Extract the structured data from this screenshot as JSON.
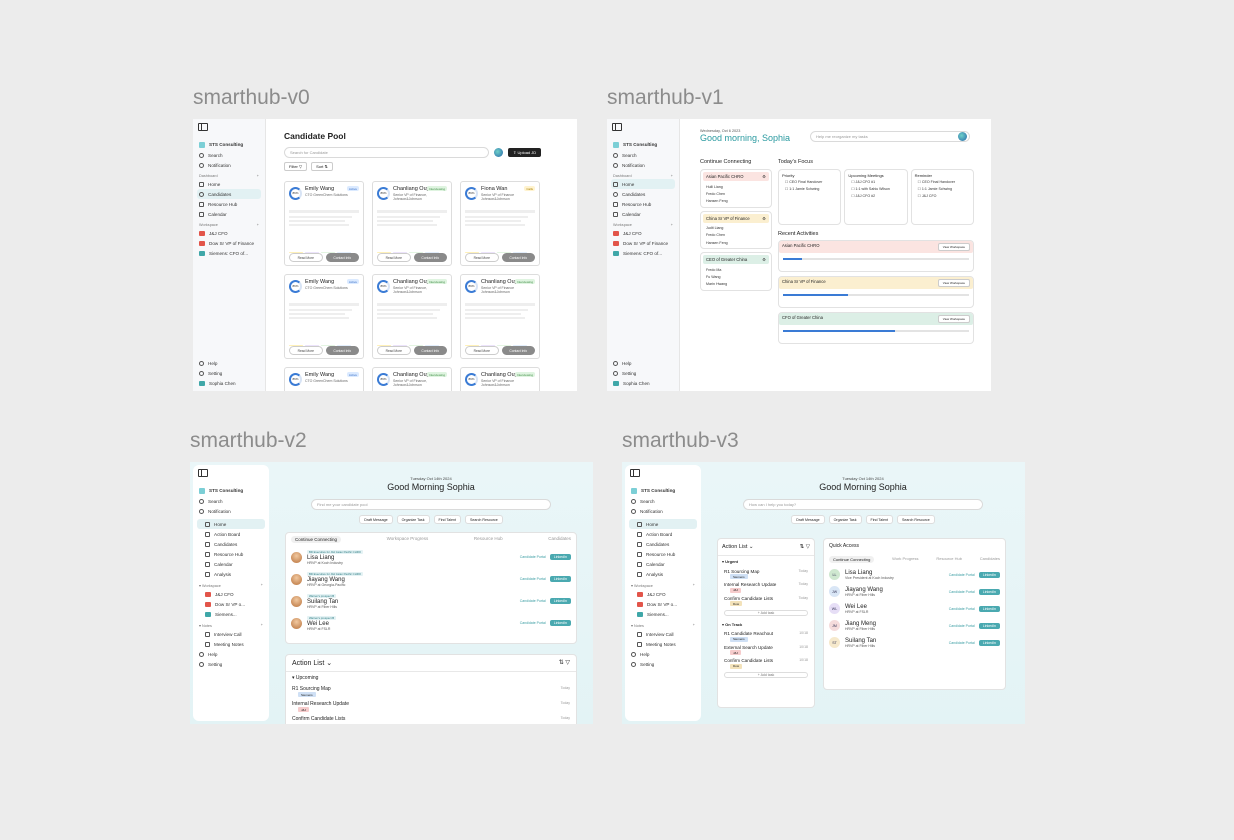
{
  "labels": {
    "v0": "smarthub-v0",
    "v1": "smarthub-v1",
    "v2": "smarthub-v2",
    "v3": "smarthub-v3"
  },
  "sidebar": {
    "org": "STS Consulting",
    "search": "Search",
    "notification": "Notification",
    "dashboard": "Dashboard",
    "home": "Home",
    "candidates": "Candidates",
    "resource_hub": "Resource Hub",
    "calendar": "Calendar",
    "workspace": "Workspace",
    "ws1": "J&J CFO",
    "ws2": "Dow Sr VP of Finance",
    "ws2_short": "Dow Sr VP o...",
    "ws3": "Siemens: CFO of...",
    "ws3_short": "Siemens...",
    "help": "Help",
    "setting": "Setting",
    "user": "Sophia Chen",
    "action_board": "Action Board",
    "analysis": "Analysis",
    "notes": "Notes",
    "interview_call": "Interview Call",
    "meeting_notes": "Meeting Notes"
  },
  "v0": {
    "title": "Candidate Pool",
    "search_placeholder": "Search for Candidate",
    "upload": "Upload JD",
    "filter": "Filter",
    "sort": "Sort",
    "cards": [
      {
        "name": "Emily Wang",
        "title": "CTO GreenChem Solutions",
        "tag": "Active",
        "tagc": "blue",
        "pct": "86%"
      },
      {
        "name": "Chanliang Ouyang",
        "title": "Senior VP of Finance, Johnson&Johnson",
        "tag": "Interviewing",
        "tagc": "green",
        "pct": "89%"
      },
      {
        "name": "Fiona Wan",
        "title": "Senior VP of Finance Johnson&Johnson",
        "tag": "Calls",
        "tagc": "yellow",
        "pct": "89%"
      },
      {
        "name": "Emily Wang",
        "title": "CTO GreenChem Solutions",
        "tag": "Active",
        "tagc": "blue",
        "pct": "86%"
      },
      {
        "name": "Chanliang Ouyang",
        "title": "Senior VP of Finance, Johnson&Johnson",
        "tag": "Interviewing",
        "tagc": "green",
        "pct": "89%"
      },
      {
        "name": "Chanliang Ouyang",
        "title": "Senior VP of Finance Johnson&Johnson",
        "tag": "Interviewing",
        "tagc": "green",
        "pct": "89%"
      },
      {
        "name": "Emily Wang",
        "title": "CTO GreenChem Solutions",
        "tag": "Active",
        "tagc": "blue",
        "pct": "86%"
      },
      {
        "name": "Chanliang Ouyang",
        "title": "Senior VP of Finance, Johnson&Johnson",
        "tag": "Interviewing",
        "tagc": "green",
        "pct": "89%"
      },
      {
        "name": "Chanliang Ouyang",
        "title": "Senior VP of Finance Johnson&Johnson",
        "tag": "Interviewing",
        "tagc": "green",
        "pct": "89%"
      }
    ],
    "read_more": "Read More",
    "contact": "Contact Info"
  },
  "v1": {
    "date": "Wednesday, Oct 6 2023",
    "greeting": "Good morning, Sophia",
    "search_placeholder": "Help me reorganize my tasks",
    "continue": "Continue Connecting",
    "focus": "Today's Focus",
    "recent": "Recent Activities",
    "groups": [
      {
        "name": "Asian Pacific CHRO",
        "c": "red",
        "rows": [
          "Hulli Liang",
          "Fredo Chen",
          "Hansen Feng"
        ]
      },
      {
        "name": "China Sr VP of Finance",
        "c": "yel",
        "rows": [
          "Judit Liang",
          "Fredo Chen",
          "Hansen Feng"
        ]
      },
      {
        "name": "CEO of Greater China",
        "c": "grn",
        "rows": [
          "Fredo Ma",
          "Fu Wang",
          "Marin Hwang"
        ]
      }
    ],
    "priority": "Priority",
    "meetings": "Upcoming Meetings",
    "reminder": "Reminder",
    "activities": [
      {
        "name": "Asian Pacific CHRO",
        "c": "red"
      },
      {
        "name": "China Sr VP of Finance",
        "c": "yel"
      },
      {
        "name": "CFO of Greater China",
        "c": "grn"
      }
    ],
    "view_workspace": "View Workspace"
  },
  "v2": {
    "date": "Tuesday Oct 14th 2024",
    "greeting": "Good Morning Sophia",
    "search_placeholder": "Find me your candidate pool",
    "actions": [
      "Draft Message",
      "Organize Task",
      "Find Talent",
      "Search Resource"
    ],
    "tabs": [
      "Continue Connecting",
      "Workspace Progress",
      "Resource Hub",
      "Candidates"
    ],
    "people": [
      {
        "tag": "BD Executive for J&J Asian Pacific CHRO",
        "name": "Lisa Liang",
        "sub": "HRVP at Koch Industry"
      },
      {
        "tag": "BD Executive for J&J Asian Pacific CHRO",
        "name": "Jiayang Wang",
        "sub": "HRVP at Georgia-Pacific"
      },
      {
        "tag": "Warren's prospect B",
        "name": "Suilang Tan",
        "sub": "HRVP at Fiber Hills"
      },
      {
        "tag": "Warren's prospect B",
        "name": "Wei Lee",
        "sub": "HRVP at FSLR"
      }
    ],
    "portal": "Candidate Portal",
    "linkedin": "LinkedIn",
    "action_list": "Action List",
    "upcoming": "Upcoming",
    "items": [
      {
        "t": "R1 Sourcing Map",
        "d": "Today",
        "m": "Siemens",
        "mc": "blue"
      },
      {
        "t": "Internal Research Update",
        "d": "Today",
        "m": "J&J",
        "mc": "red"
      },
      {
        "t": "Confirm Candidate Lists",
        "d": "Today",
        "m": "",
        "mc": ""
      }
    ]
  },
  "v3": {
    "date": "Tuesday Oct 14th 2024",
    "greeting": "Good Morning Sophia",
    "search_placeholder": "How can I help you today?",
    "actions": [
      "Draft Message",
      "Organize Task",
      "Find Talent",
      "Search Resource"
    ],
    "action_list": "Action List",
    "urgent": "Urgent",
    "on_track": "On Track",
    "add_task": "Add task",
    "urgent_items": [
      {
        "t": "R1 Sourcing Map",
        "d": "Today",
        "m": "Siemens",
        "mc": "blue"
      },
      {
        "t": "Internal Research Update",
        "d": "Today",
        "m": "J&J",
        "mc": "red"
      },
      {
        "t": "Confirm Candidate Lists",
        "d": "Today",
        "m": "Dow",
        "mc": "yel"
      }
    ],
    "track_items": [
      {
        "t": "R1 Candidate Reachout",
        "d": "10/18",
        "m": "Siemens",
        "mc": "blue"
      },
      {
        "t": "External Search Update",
        "d": "10/18",
        "m": "J&J",
        "mc": "red"
      },
      {
        "t": "Confirm Candidate Lists",
        "d": "10/18",
        "m": "Dow",
        "mc": "yel"
      }
    ],
    "quick_access": "Quick Access",
    "tabs": [
      "Continue Connecting",
      "Work Progress",
      "Resource Hub",
      "Candidates"
    ],
    "people": [
      {
        "ini": "LL",
        "name": "Lisa Liang",
        "sub": "Vice President at Koch Industry",
        "c": "#cfe8d0"
      },
      {
        "ini": "JW",
        "name": "Jiayang Wang",
        "sub": "HRVP at Fiber Hills",
        "c": "#d9e6f6"
      },
      {
        "ini": "WL",
        "name": "Wei Lee",
        "sub": "HRVP at FSLR",
        "c": "#e6def6"
      },
      {
        "ini": "JM",
        "name": "Jiang Meng",
        "sub": "HRVP at Fiber Hills",
        "c": "#f5dcdc"
      },
      {
        "ini": "ST",
        "name": "Suilang Tan",
        "sub": "HRVP at Fiber Hills",
        "c": "#f6e9cc"
      }
    ],
    "portal": "Candidate Portal",
    "linkedin": "LinkedIn"
  }
}
